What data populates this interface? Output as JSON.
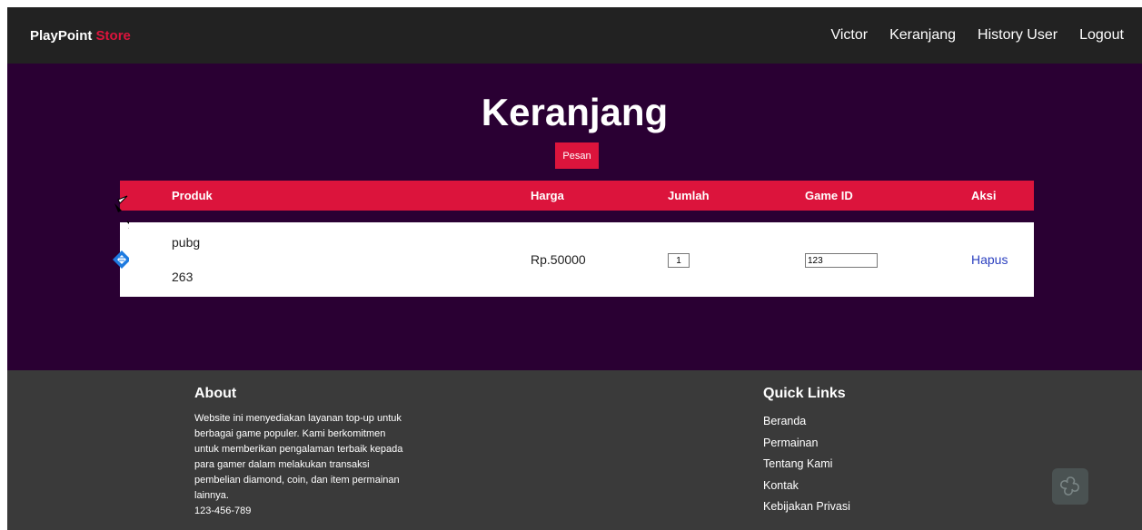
{
  "navbar": {
    "brand_main": "PlayPoint",
    "brand_accent": "Store",
    "links": [
      "Victor",
      "Keranjang",
      "History User",
      "Logout"
    ]
  },
  "page": {
    "title": "Keranjang",
    "pesan_label": "Pesan"
  },
  "table": {
    "headers": [
      "Produk",
      "Harga",
      "Jumlah",
      "Game ID",
      "Aksi"
    ],
    "rows": [
      {
        "product_name": "pubg",
        "product_amount": "263",
        "price": "Rp.50000",
        "quantity": "1",
        "game_id": "123",
        "action": "Hapus"
      }
    ]
  },
  "footer": {
    "about_title": "About",
    "about_text": "Website ini menyediakan layanan top-up untuk berbagai game populer. Kami berkomitmen untuk memberikan pengalaman terbaik kepada para gamer dalam melakukan transaksi pembelian diamond, coin, dan item permainan lainnya.",
    "phone_partial": "123-456-789",
    "quick_title": "Quick Links",
    "quick_links": [
      "Beranda",
      "Permainan",
      "Tentang Kami",
      "Kontak",
      "Kebijakan Privasi"
    ]
  },
  "colors": {
    "navbar_bg": "#222222",
    "accent": "#dc143c",
    "main_bg": "#2a0033",
    "footer_bg": "#3a3a3a",
    "link_blue": "#2a3fbf"
  },
  "icons": [
    "cursor-tool-icon",
    "bookmark-diamond-icon",
    "floating-widget-icon"
  ]
}
